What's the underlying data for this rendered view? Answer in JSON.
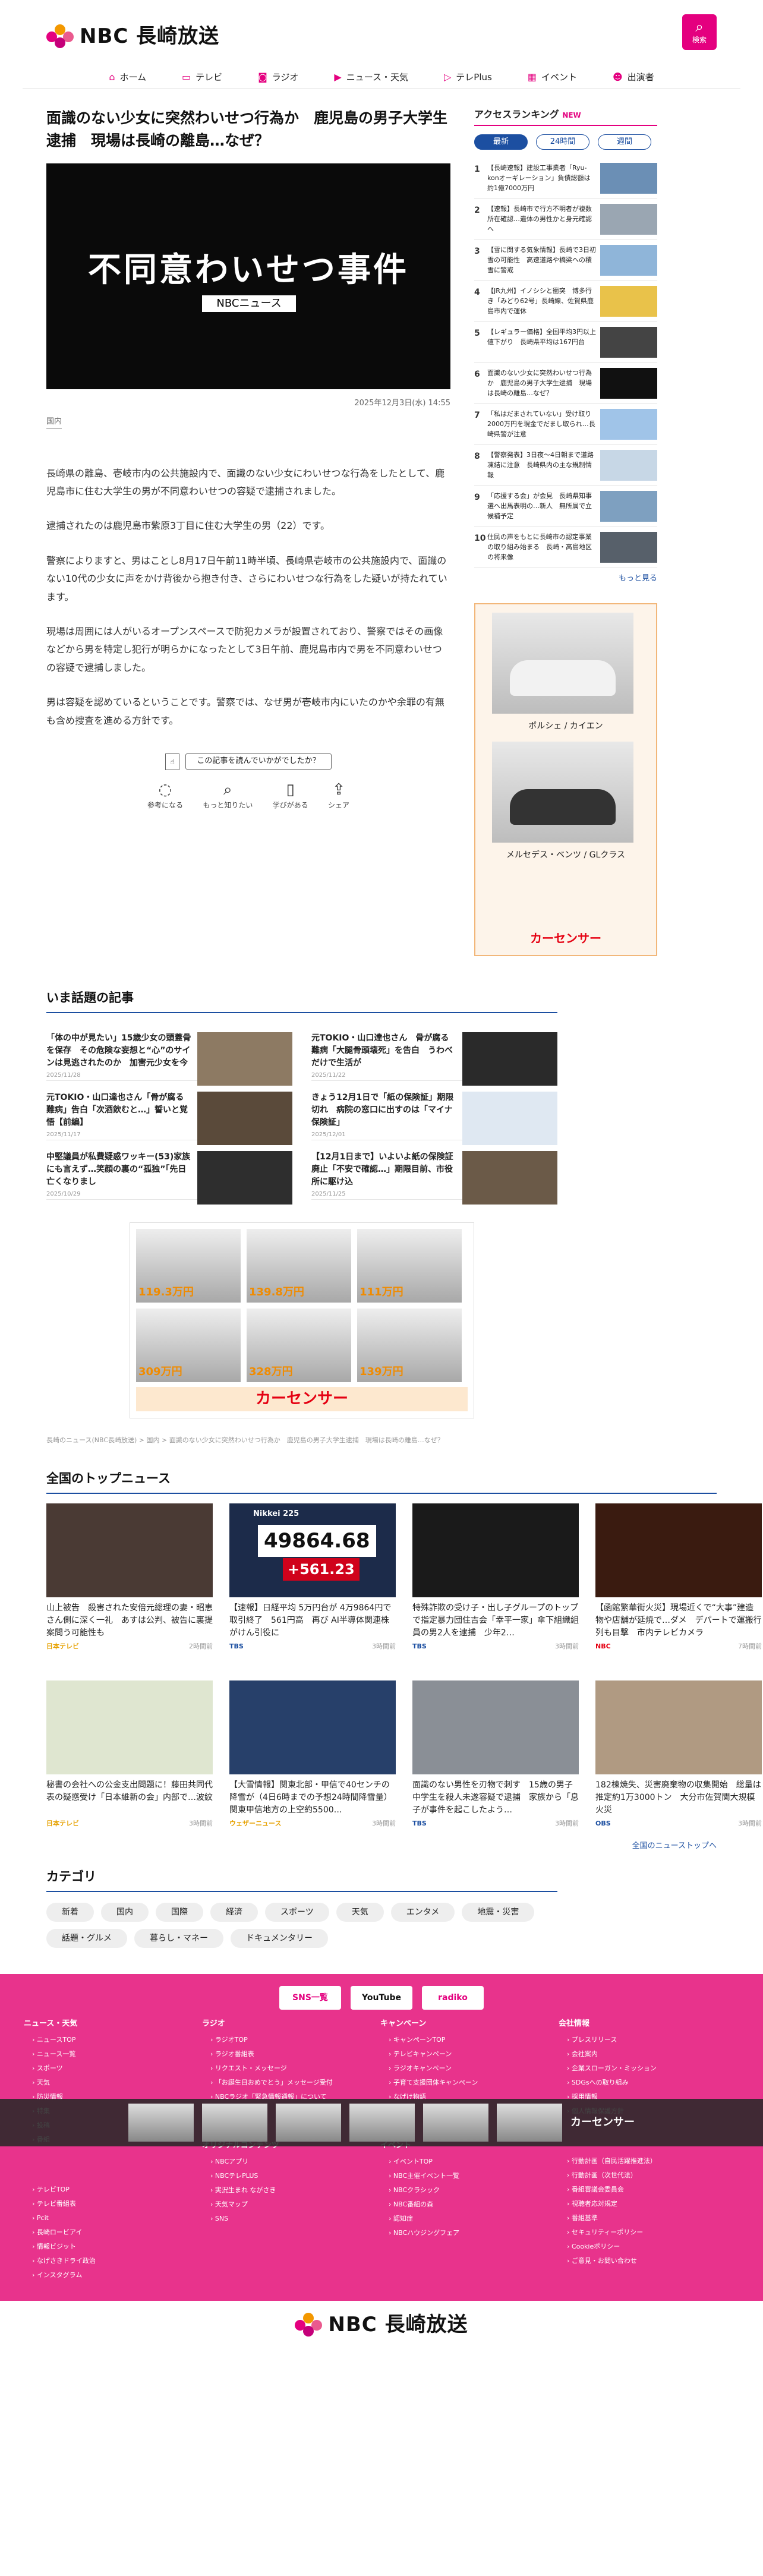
{
  "header": {
    "logo_text": "NBC 長崎放送",
    "search_label": "検索",
    "nav": [
      {
        "label": "ホーム",
        "icon": "home-icon"
      },
      {
        "label": "テレビ",
        "icon": "tv-icon"
      },
      {
        "label": "ラジオ",
        "icon": "radio-icon"
      },
      {
        "label": "ニュース・天気",
        "icon": "news-icon"
      },
      {
        "label": "テレPlus",
        "icon": "play-icon"
      },
      {
        "label": "イベント",
        "icon": "calendar-icon"
      },
      {
        "label": "出演者",
        "icon": "people-icon"
      }
    ]
  },
  "article": {
    "title": "面識のない少女に突然わいせつ行為か　鹿児島の男子大学生逮捕　現場は長崎の離島…なぜ？",
    "hero_heading": "不同意わいせつ事件",
    "hero_sub": "NBCニュース",
    "date": "2025年12月3日(水) 14:55",
    "category": "国内",
    "paragraphs": [
      "長崎県の離島、壱岐市内の公共施設内で、面識のない少女にわいせつな行為をしたとして、鹿児島市に住む大学生の男が不同意わいせつの容疑で逮捕されました。",
      "逮捕されたのは鹿児島市紫原3丁目に住む大学生の男（22）です。",
      "警察によりますと、男はことし8月17日午前11時半頃、長崎県壱岐市の公共施設内で、面識のない10代の少女に声をかけ背後から抱き付き、さらにわいせつな行為をした疑いが持たれています。",
      "現場は周囲には人がいるオープンスペースで防犯カメラが設置されており、警察ではその画像などから男を特定し犯行が明らかになったとして3日午前、鹿児島市内で男を不同意わいせつの容疑で逮捕しました。",
      "男は容疑を認めているということです。警察では、なぜ男が壱岐市内にいたのかや余罪の有無も含め捜査を進める方針です。"
    ],
    "feedback_question": "この記事を読んでいかがでしたか？",
    "feedback_buttons": [
      {
        "label": "参考になる",
        "icon": "lightbulb-icon"
      },
      {
        "label": "もっと知りたい",
        "icon": "magnifier-icon"
      },
      {
        "label": "学びがある",
        "icon": "book-icon"
      },
      {
        "label": "シェア",
        "icon": "share-icon"
      }
    ]
  },
  "sidebar": {
    "ranking_title": "アクセスランキング",
    "ranking_badge": "NEW",
    "tabs": [
      "最新",
      "24時間",
      "週間"
    ],
    "items": [
      {
        "rank": "1",
        "text": "【長崎速報】建設工事業者「Ryu-konオーギレーション」負債総額は約1億7000万円"
      },
      {
        "rank": "2",
        "text": "【速報】長崎市で行方不明者が複数所在確認…遺体の男性かと身元確認へ"
      },
      {
        "rank": "3",
        "text": "【雪に関する気象情報】長崎で3日初雪の可能性　高速道路や橋梁への積雪に警戒"
      },
      {
        "rank": "4",
        "text": "【JR九州】イノシシと衝突　博多行き「みどり62号」長崎線、佐賀県鹿島市内で運休"
      },
      {
        "rank": "5",
        "text": "【レギュラー価格】全国平均3円以上値下がり　長崎県平均は167円台"
      },
      {
        "rank": "6",
        "text": "面識のない少女に突然わいせつ行為か　鹿児島の男子大学生逮捕　現場は長崎の離島…なぜ？"
      },
      {
        "rank": "7",
        "text": "「私はだまされていない」受け取り2000万円を現金でだまし取られ…長崎県警が注意"
      },
      {
        "rank": "8",
        "text": "【警察発表】3日夜～4日朝まで道路凍結に注意　長崎県内の主な規制情報"
      },
      {
        "rank": "9",
        "text": "「応援する会」が会見　長崎県知事選へ出馬表明の…新人　無所属で立候補予定"
      },
      {
        "rank": "10",
        "text": "住民の声をもとに長崎市の認定事業の取り組み始まる　長崎・高島地区の将来像"
      }
    ],
    "more": "もっと見る",
    "ad": {
      "car1": "ポルシェ / カイエン",
      "car2": "メルセデス・ベンツ / GLクラス",
      "brand": "カーセンサー"
    }
  },
  "popular": {
    "title": "いま話題の記事",
    "items": [
      {
        "text": "「体の中が見たい」15歳少女の頭蓋骨を保存　その危険な妄想と“心”のサインは見逃されたのか　加害元少女を今",
        "date": "2025/11/28"
      },
      {
        "text": "元TOKIO・山口達也さん　骨が腐る難病「大腿骨頭壊死」を告白　うわべだけで生活が",
        "date": "2025/11/22"
      },
      {
        "text": "元TOKIO・山口達也さん「骨が腐る難病」告白「次酒飲むと…」誓いと覚悟【前編】",
        "date": "2025/11/17"
      },
      {
        "text": "きょう12月1日で「紙の保険証」期限切れ　病院の窓口に出すのは「マイナ保険証」",
        "date": "2025/12/01"
      },
      {
        "text": "中堅議員が私費疑惑ワッキー(53)家族にも言えず…笑顔の裏の“孤独”「先日亡くなりまし",
        "date": "2025/10/29"
      },
      {
        "text": "【12月1日まで】いよいよ紙の保険証廃止「不安で確認…」期限目前、市役所に駆け込",
        "date": "2025/11/25"
      }
    ]
  },
  "ad_banner": {
    "prices": [
      "119.3万円",
      "139.8万円",
      "111万円",
      "309万円",
      "328万円",
      "139万円"
    ],
    "brand": "カーセンサー"
  },
  "breadcrumb": "長崎のニュース(NBC長崎放送) > 国内 > 面識のない少女に突然わいせつ行為か　鹿児島の男子大学生逮捕　現場は長崎の離島…なぜ？",
  "topnews": {
    "title": "全国のトップニュース",
    "items": [
      {
        "text": "山上被告　殺害された安倍元総理の妻・昭恵さん側に深く一礼　あすは公判、被告に裏提案問う可能性も",
        "src": "日本テレビ",
        "time": "2時間前"
      },
      {
        "text": "【速報】日経平均 5万円台が 4万9864円で取引終了　561円高　再び AI半導体関連株がけん引役に",
        "src": "TBS",
        "time": "3時間前"
      },
      {
        "text": "特殊詐欺の受け子・出し子グループのトップで指定暴力団住吉会「幸平一家」傘下組織組員の男2人を逮捕　少年2…",
        "src": "TBS",
        "time": "3時間前"
      },
      {
        "text": "【函館繁華街火災】現場近くで“大事”建造物や店舗が延焼で…ダメ　デパートで運搬行列も目撃　市内テレビカメラ",
        "src": "NBC",
        "time": "7時間前"
      },
      {
        "text": "秘書の会社への公金支出問題に！藤田共同代表の疑惑受け「日本維新の会」内部で…波紋",
        "src": "日本テレビ",
        "time": "3時間前"
      },
      {
        "text": "【大雪情報】関東北部・甲信で40センチの降雪が（4日6時までの予想24時間降雪量）関東甲信地方の上空約5500…",
        "src": "ウェザーニュース",
        "time": "3時間前"
      },
      {
        "text": "面識のない男性を刃物で刺す　15歳の男子中学生を殺人未遂容疑で逮捕　家族から「息子が事件を起こしたよう…",
        "src": "TBS",
        "time": "3時間前"
      },
      {
        "text": "182棟焼失、災害廃棄物の収集開始　総量は推定約1万3000トン　大分市佐賀関大規模火災",
        "src": "OBS",
        "time": "3時間前"
      }
    ],
    "ticker_label": "Nikkei 225",
    "ticker_value": "49864.68",
    "ticker_change": "+561.23",
    "all_link": "全国のニューストップへ"
  },
  "categories": {
    "title": "カテゴリ",
    "items": [
      "新着",
      "国内",
      "国際",
      "経済",
      "スポーツ",
      "天気",
      "エンタメ",
      "地震・災害",
      "話題・グルメ",
      "暮らし・マネー",
      "ドキュメンタリー"
    ]
  },
  "footer": {
    "sns": [
      "SNS一覧",
      "YouTube",
      "radiko"
    ],
    "columns": [
      {
        "heading": "ニュース・天気",
        "links": [
          "ニュースTOP",
          "ニュース一覧",
          "スポーツ",
          "天気",
          "防災情報",
          "特集",
          "投稿",
          "番組"
        ]
      },
      {
        "heading": "ラジオ",
        "links": [
          "ラジオTOP",
          "ラジオ番組表",
          "リクエスト・メッセージ",
          "「お誕生日おめでとう」メッセージ受付",
          "NBCラジオ「緊急情報通報」について"
        ]
      },
      {
        "heading": "キャンペーン",
        "links": [
          "キャンペーンTOP",
          "テレビキャンペーン",
          "ラジオキャンペーン",
          "子育て支援団体キャンペーン",
          "なげけ物語"
        ]
      },
      {
        "heading": "会社情報",
        "links": [
          "プレスリリース",
          "会社案内",
          "企業スローガン・ミッション",
          "SDGsへの取り組み",
          "採用情報",
          "個人情報保護方針"
        ]
      }
    ],
    "col2": [
      {
        "heading": "",
        "links": [
          "テレビTOP",
          "テレビ番組表",
          "Pcit",
          "長崎ロービアイ",
          "情報ビジット",
          "なげさきドライ政治",
          "インスタグラム"
        ]
      },
      {
        "heading": "オリジナルコンテンツ",
        "links": [
          "NBCアプリ",
          "NBCテレPLUS",
          "実況生まれ ながさき",
          "天気マップ",
          "SNS"
        ]
      },
      {
        "heading": "イベント",
        "links": [
          "イベントTOP",
          "NBC主催イベント一覧",
          "NBCクラシック",
          "NBC番組の森",
          "認知症",
          "NBCハウジングフェア"
        ]
      },
      {
        "heading": "",
        "links": [
          "行動計画（自民活躍推進法）",
          "行動計画（次世代法）",
          "番組審議会委員会",
          "視聴者応対規定",
          "番組基準",
          "セキュリティーポリシー",
          "Cookieポリシー",
          "ご意見・お問い合わせ"
        ]
      }
    ],
    "logo_text": "NBC 長崎放送"
  }
}
